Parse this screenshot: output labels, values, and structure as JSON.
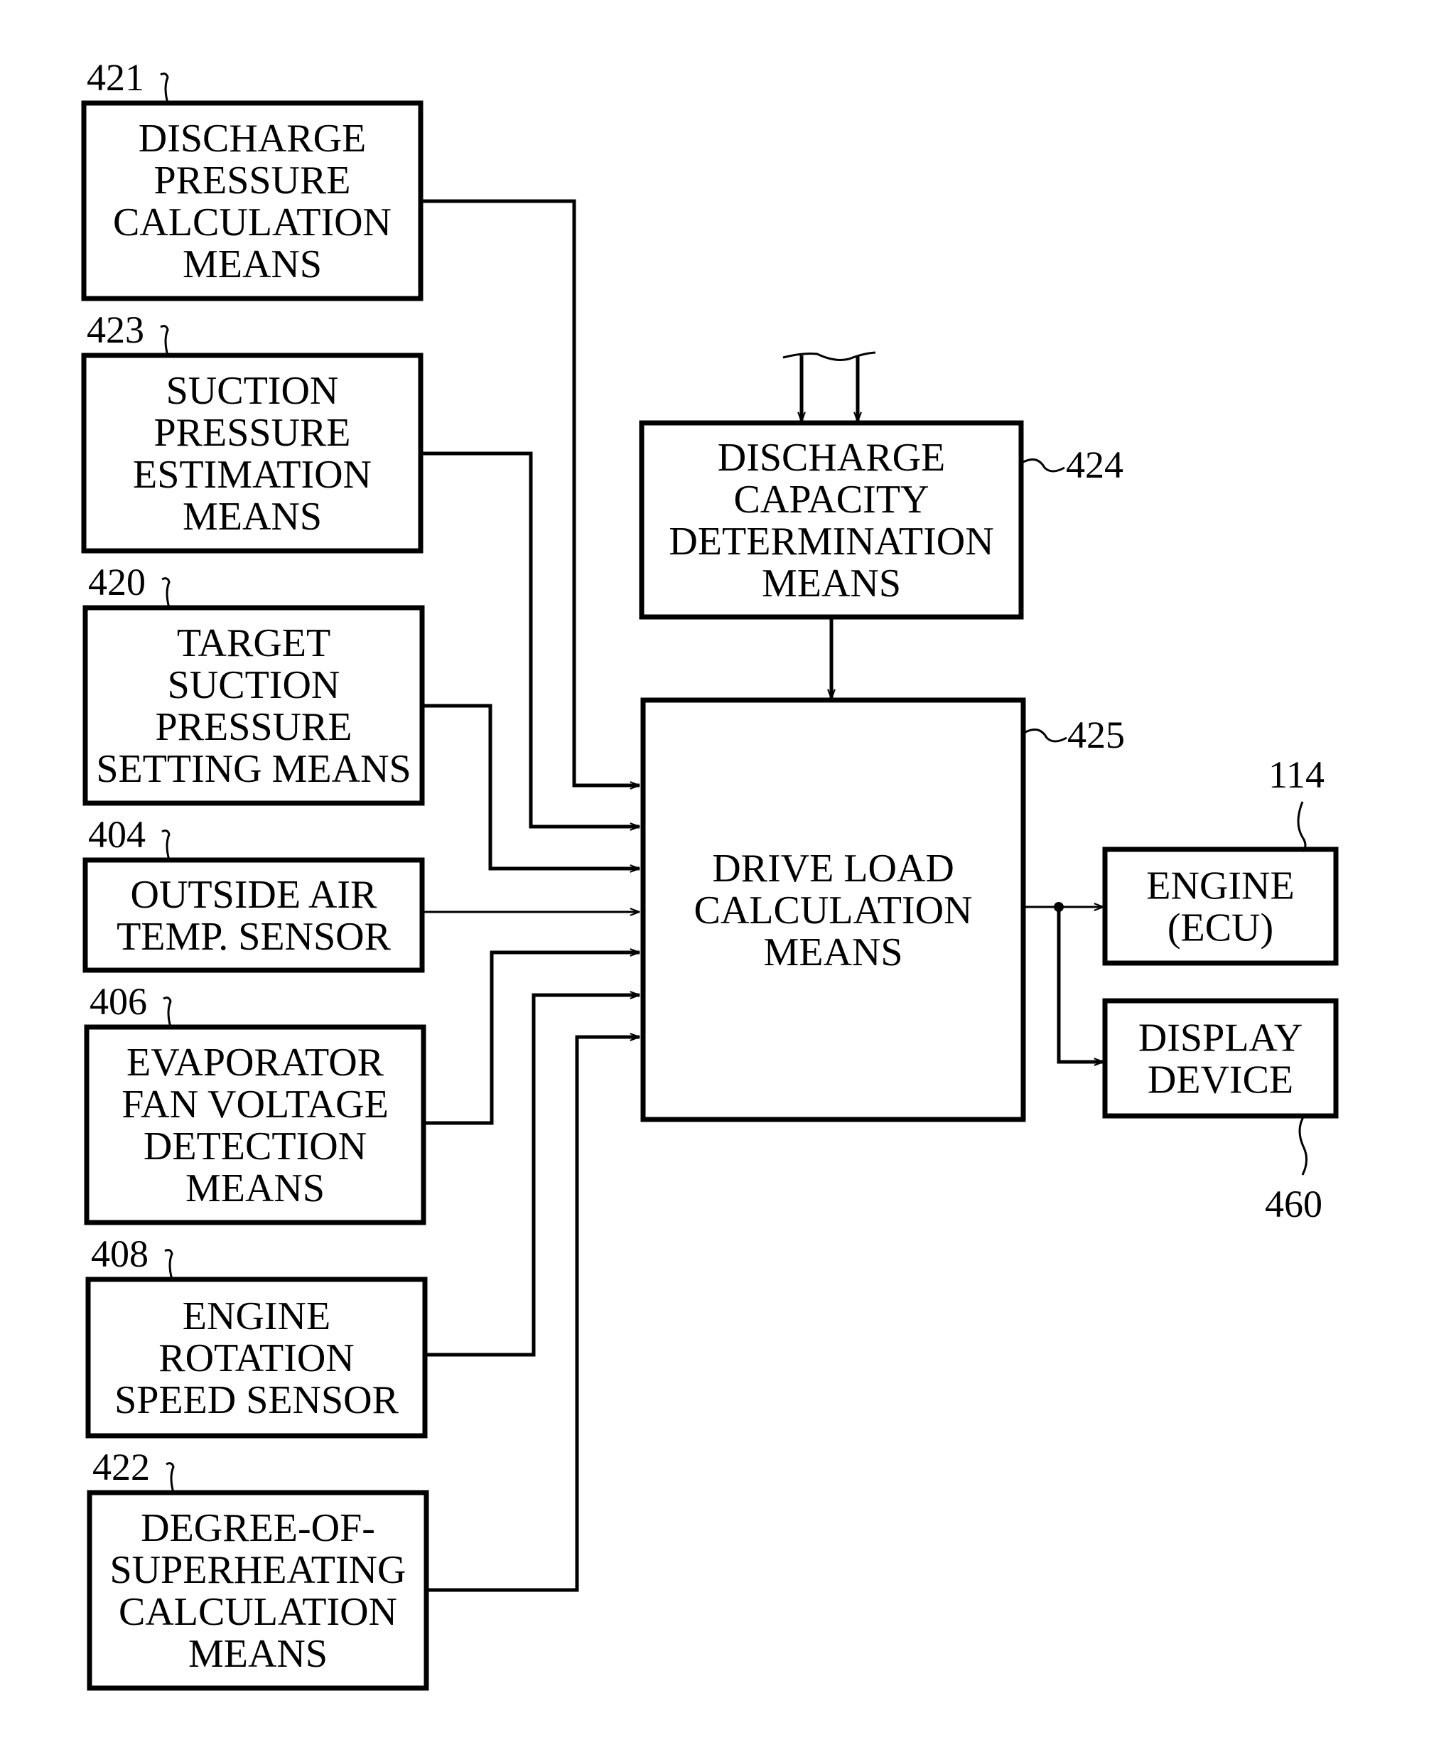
{
  "figure": {
    "inputs": [
      {
        "ref": "421",
        "lines": [
          "DISCHARGE",
          "PRESSURE",
          "CALCULATION",
          "MEANS"
        ]
      },
      {
        "ref": "423",
        "lines": [
          "SUCTION",
          "PRESSURE",
          "ESTIMATION",
          "MEANS"
        ]
      },
      {
        "ref": "420",
        "lines": [
          "TARGET",
          "SUCTION",
          "PRESSURE",
          "SETTING MEANS"
        ]
      },
      {
        "ref": "404",
        "lines": [
          "OUTSIDE AIR",
          "TEMP. SENSOR"
        ]
      },
      {
        "ref": "406",
        "lines": [
          "EVAPORATOR",
          "FAN VOLTAGE",
          "DETECTION",
          "MEANS"
        ]
      },
      {
        "ref": "408",
        "lines": [
          "ENGINE",
          "ROTATION",
          "SPEED SENSOR"
        ]
      },
      {
        "ref": "422",
        "lines": [
          "DEGREE-OF-",
          "SUPERHEATING",
          "CALCULATION",
          "MEANS"
        ]
      }
    ],
    "capacity": {
      "ref": "424",
      "lines": [
        "DISCHARGE",
        "CAPACITY",
        "DETERMINATION",
        "MEANS"
      ]
    },
    "drive_load": {
      "ref": "425",
      "lines": [
        "DRIVE LOAD",
        "CALCULATION",
        "MEANS"
      ]
    },
    "engine": {
      "ref": "114",
      "lines": [
        "ENGINE",
        "(ECU)"
      ]
    },
    "display": {
      "ref": "460",
      "lines": [
        "DISPLAY",
        "DEVICE"
      ]
    }
  }
}
